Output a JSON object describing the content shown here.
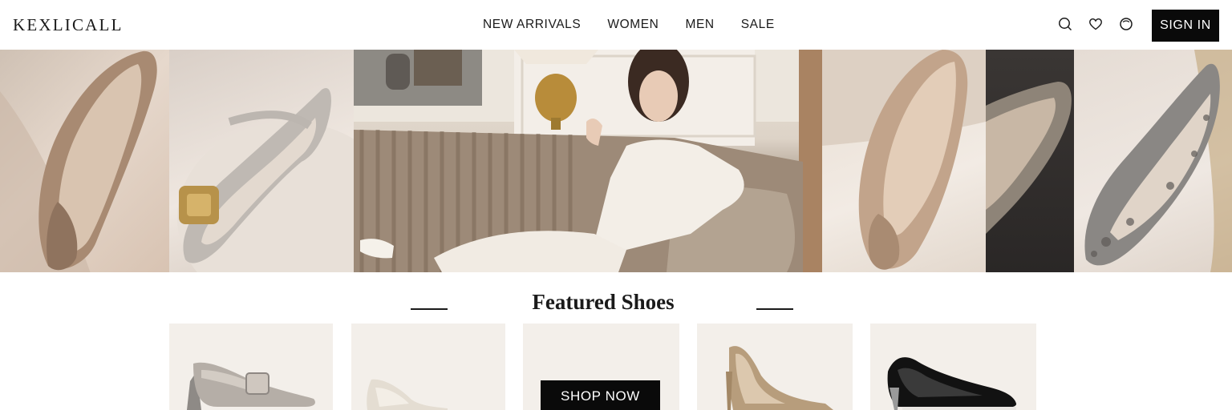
{
  "header": {
    "logo": "KEXLICALL",
    "nav": [
      {
        "label": "NEW ARRIVALS"
      },
      {
        "label": "WOMEN"
      },
      {
        "label": "MEN"
      },
      {
        "label": "SALE"
      }
    ],
    "icons": [
      "search-icon",
      "heart-icon",
      "bag-icon"
    ],
    "signin_label": "SIGN IN"
  },
  "hero": {
    "panels": [
      "metallic-flat-shoe",
      "silver-buckle-flat",
      "model-on-sofa",
      "rose-gold-flat",
      "shoe-on-dark",
      "snakeskin-flat"
    ]
  },
  "featured": {
    "title": "Featured Shoes",
    "shop_now_label": "SHOP NOW",
    "products": [
      "pewter-buckle-pump",
      "ivory-pump",
      "promo-shop-now",
      "nude-stiletto",
      "black-patent-pump"
    ]
  },
  "colors": {
    "accent": "#0a0a0a",
    "background": "#ffffff",
    "card_bg": "#f3efea"
  }
}
